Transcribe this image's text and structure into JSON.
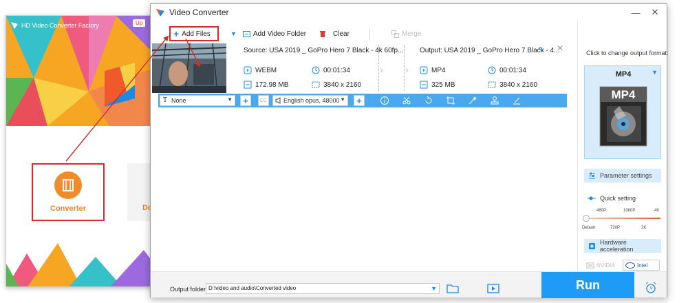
{
  "background_app": {
    "title": "HD Video Converter Factory",
    "upgrade_label": "Up",
    "converter_label": "Converter",
    "next_tile_label": "Do"
  },
  "window": {
    "title": "Video Converter",
    "minimize": "—",
    "close": "✕"
  },
  "toolbar": {
    "add_files": "Add Files",
    "add_video_folder": "Add Video Folder",
    "clear": "Clear",
    "merge": "Merge"
  },
  "file_item": {
    "source_name": "Source: USA 2019 _ GoPro Hero 7 Black - 4k 60fp...",
    "output_name": "Output: USA 2019 _ GoPro Hero 7 Black - 4...",
    "source": {
      "format": "WEBM",
      "duration": "00:01:34",
      "size": "172.98 MB",
      "resolution": "3840 x 2160"
    },
    "output": {
      "format": "MP4",
      "duration": "00:01:34",
      "size": "325 MB",
      "resolution": "3840 x 2160"
    }
  },
  "edit_bar": {
    "subtitle_value": "None",
    "cc_label": "CC",
    "audio_value": "English opus, 48000"
  },
  "right_panel": {
    "hint": "Click to change output format:",
    "format_name": "MP4",
    "format_icon_text": "MP4",
    "parameter_settings": "Parameter settings",
    "quick_setting": "Quick setting",
    "quick_setting_level": 0,
    "ticks_top": [
      "480P",
      "1080P",
      "4K"
    ],
    "ticks_bottom": [
      "Default",
      "720P",
      "2K"
    ],
    "hardware_acceleration": "Hardware acceleration",
    "nvidia": "NVIDIA",
    "intel": "Intel"
  },
  "bottom": {
    "output_folder_label": "Output folder:",
    "output_folder_path": "D:\\video and audio\\Converted video",
    "run": "Run"
  },
  "colors": {
    "accent_blue": "#1e9af7",
    "edit_bar_blue": "#4aa9ee",
    "annotation_red": "#d42b2b",
    "orange": "#e8832a"
  }
}
